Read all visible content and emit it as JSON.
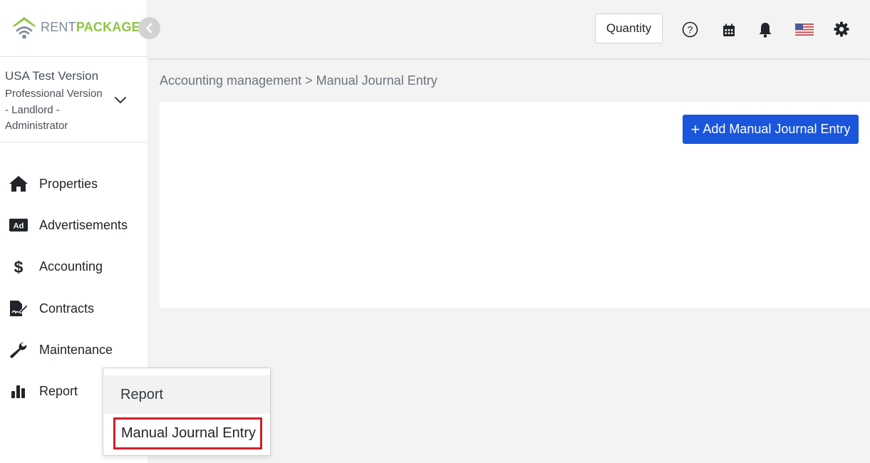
{
  "brand": {
    "name_part1": "RENT",
    "name_part2": "PACKAGE",
    "colors": {
      "primary_green": "#8cc63f",
      "text_gray": "#7d8a99"
    }
  },
  "sidebar": {
    "collapse_icon": "chevron-left-icon",
    "account": {
      "name": "USA Test Version",
      "role": "Professional Version - Landlord - Administrator",
      "dropdown_icon": "chevron-down-icon"
    },
    "nav_items": [
      {
        "label": "Properties",
        "icon": "home-icon"
      },
      {
        "label": "Advertisements",
        "icon": "ad-icon"
      },
      {
        "label": "Accounting",
        "icon": "dollar-icon"
      },
      {
        "label": "Contracts",
        "icon": "contract-icon"
      },
      {
        "label": "Maintenance",
        "icon": "wrench-icon"
      },
      {
        "label": "Report",
        "icon": "bar-chart-icon"
      }
    ]
  },
  "header": {
    "quantity_label": "Quantity",
    "icons": [
      "help-icon",
      "calendar-icon",
      "bell-icon",
      "us-flag-icon",
      "gear-icon"
    ]
  },
  "main": {
    "breadcrumb": "Accounting management > Manual Journal Entry",
    "add_button_label": "Add Manual Journal Entry",
    "accent_color": "#1a56db"
  },
  "submenu": {
    "items": [
      {
        "label": "Report"
      },
      {
        "label": "Manual Journal Entry",
        "highlighted": true,
        "highlight_color": "#d11f2a"
      }
    ]
  }
}
